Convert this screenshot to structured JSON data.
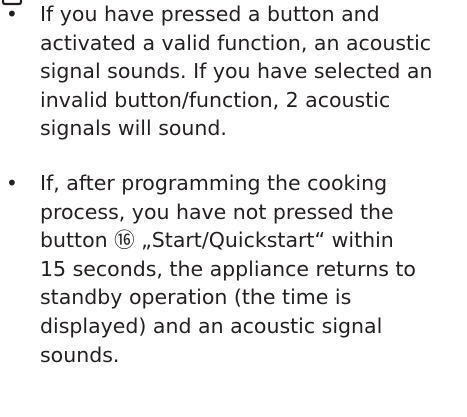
{
  "notes": [
    {
      "bullet": "•",
      "lines": [
        "If you have pressed a button and",
        "activated a valid function, an acoustic",
        "signal sounds. If you have selected an",
        "invalid button/function, 2 acoustic",
        "signals will sound."
      ]
    },
    {
      "bullet": "•",
      "lines": [
        "If, after programming the cooking",
        "process, you have not pressed the",
        "button ⑯ „Start/Quickstart“ within",
        "15 seconds, the appliance returns to",
        "standby operation (the time is",
        "displayed) and an acoustic signal",
        "sounds."
      ]
    }
  ]
}
